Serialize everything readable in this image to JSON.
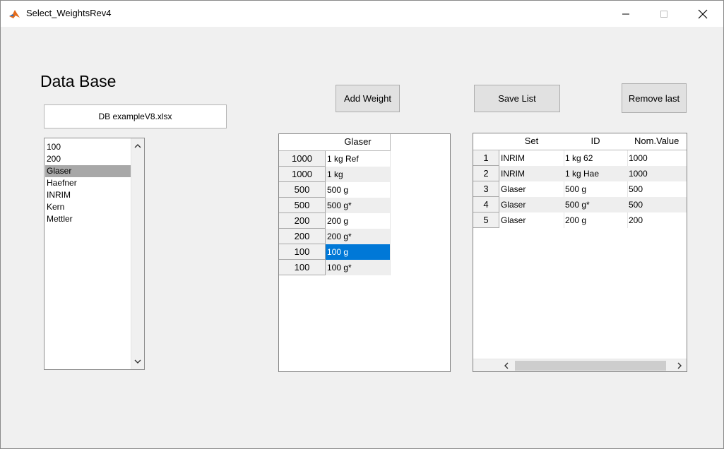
{
  "window": {
    "title": "Select_WeightsRev4",
    "minimize_symbol": "—",
    "maximize_symbol": "☐",
    "close_symbol": "✕"
  },
  "database": {
    "heading": "Data Base",
    "file_name": "DB exampleV8.xlsx",
    "items": [
      "100",
      "200",
      "Glaser",
      "Haefner",
      "INRIM",
      "Kern",
      "Mettler"
    ],
    "selected_index": 2
  },
  "buttons": {
    "add_weight": "Add Weight",
    "save_list": "Save List",
    "remove_last": "Remove last"
  },
  "weights_table": {
    "column_header": "Glaser",
    "rows": [
      {
        "nominal": "1000",
        "name": "1 kg Ref"
      },
      {
        "nominal": "1000",
        "name": "1 kg"
      },
      {
        "nominal": "500",
        "name": "500 g"
      },
      {
        "nominal": "500",
        "name": "500 g*"
      },
      {
        "nominal": "200",
        "name": "200 g"
      },
      {
        "nominal": "200",
        "name": "200 g*"
      },
      {
        "nominal": "100",
        "name": "100 g"
      },
      {
        "nominal": "100",
        "name": "100 g*"
      }
    ],
    "selected_row": 6
  },
  "selected_list": {
    "headers": [
      "Set",
      "ID",
      "Nom.Value"
    ],
    "rows": [
      {
        "n": "1",
        "set": "INRIM",
        "id": "1 kg 62",
        "value": "1000"
      },
      {
        "n": "2",
        "set": "INRIM",
        "id": "1 kg Hae",
        "value": "1000"
      },
      {
        "n": "3",
        "set": "Glaser",
        "id": "500 g",
        "value": "500"
      },
      {
        "n": "4",
        "set": "Glaser",
        "id": "500 g*",
        "value": "500"
      },
      {
        "n": "5",
        "set": "Glaser",
        "id": "200 g",
        "value": "200"
      }
    ]
  },
  "scroll_symbols": {
    "up": "▲",
    "down": "▼",
    "left": "◀",
    "right": "▶"
  }
}
